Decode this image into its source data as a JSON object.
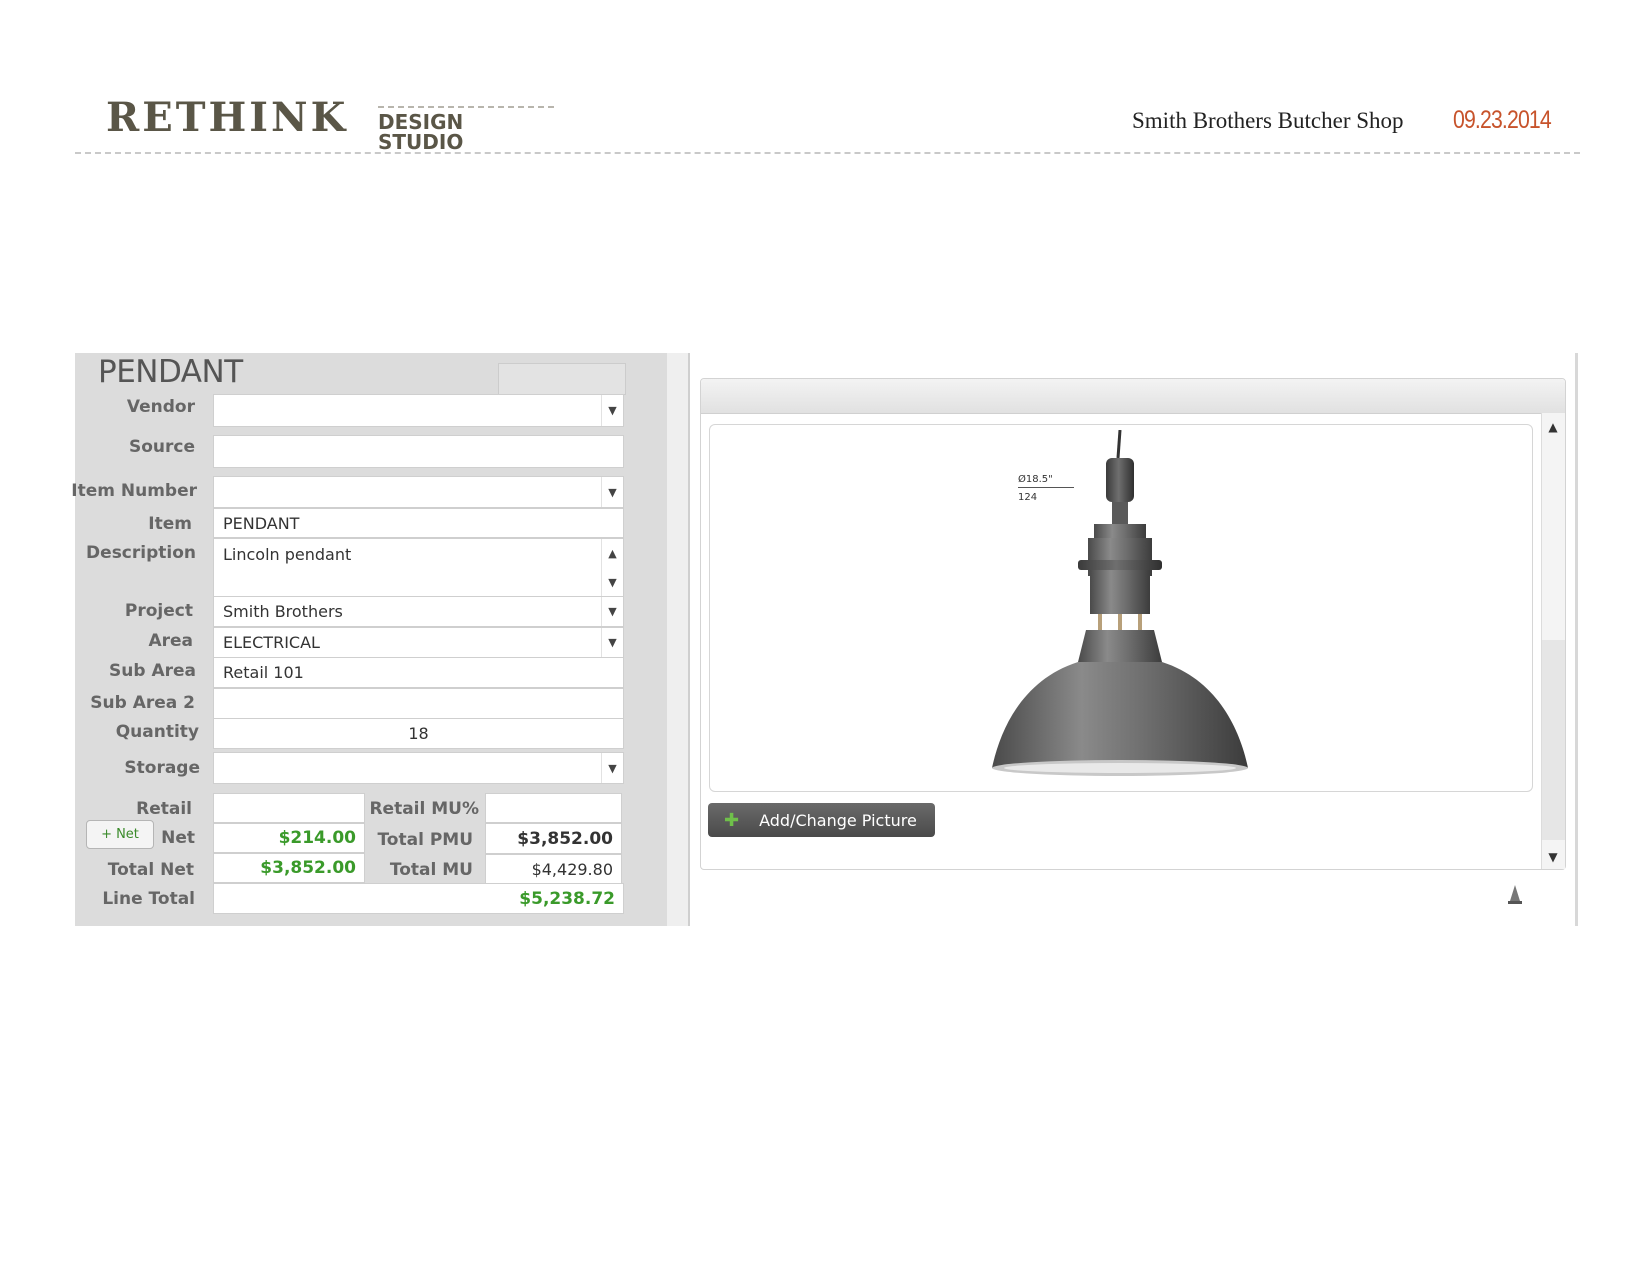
{
  "header": {
    "logo_main": "RETHINK",
    "logo_sub": "DESIGN STUDIO",
    "project_name": "Smith Brothers Butcher Shop",
    "date": "09.23.2014"
  },
  "form": {
    "title": "PENDANT",
    "labels": {
      "vendor": "Vendor",
      "source": "Source",
      "item_number": "Item Number",
      "item": "Item",
      "description": "Description",
      "project": "Project",
      "area": "Area",
      "sub_area": "Sub Area",
      "sub_area_2": "Sub Area 2",
      "quantity": "Quantity",
      "storage": "Storage",
      "retail": "Retail",
      "net": "Net",
      "total_net": "Total Net",
      "line_total": "Line Total",
      "retail_mu_pct": "Retail MU%",
      "total_pmu": "Total PMU",
      "total_mu": "Total MU"
    },
    "values": {
      "vendor": "",
      "source": "",
      "item_number": "",
      "item": "PENDANT",
      "description": "Lincoln pendant",
      "project": "Smith Brothers",
      "area": "ELECTRICAL",
      "sub_area": "Retail 101",
      "sub_area_2": "",
      "quantity": "18",
      "storage": "",
      "retail": "",
      "net": "$214.00",
      "total_net": "$3,852.00",
      "line_total": "$5,238.72",
      "retail_mu_pct": "",
      "total_pmu": "$3,852.00",
      "total_mu": "$4,429.80"
    },
    "net_button_label": "+ Net"
  },
  "image_panel": {
    "add_picture_label": "Add/Change Picture",
    "dimension_diameter": "Ø18.5\"",
    "dimension_code": "124"
  },
  "icons": {
    "dropdown": "▼",
    "up": "▲",
    "down": "▼"
  },
  "colors": {
    "brand": "#5a5647",
    "date": "#c7532b",
    "money_green": "#3a9a2a",
    "panel_bg": "#dcdcdc"
  }
}
